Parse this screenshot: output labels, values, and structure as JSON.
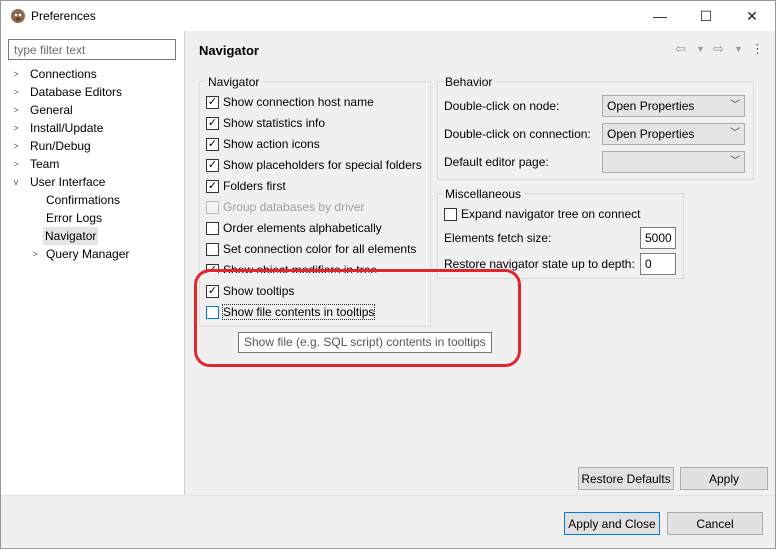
{
  "window": {
    "title": "Preferences",
    "icon": "beaver-logo-icon",
    "minimize": "—",
    "maximize": "☐",
    "close": "✕"
  },
  "filter": {
    "placeholder": "type filter text",
    "value": ""
  },
  "tree": {
    "items": [
      {
        "label": "Connections"
      },
      {
        "label": "Database Editors"
      },
      {
        "label": "General"
      },
      {
        "label": "Install/Update"
      },
      {
        "label": "Run/Debug"
      },
      {
        "label": "Team"
      },
      {
        "label": "User Interface"
      },
      {
        "label": "Confirmations"
      },
      {
        "label": "Error Logs"
      },
      {
        "label": "Navigator"
      },
      {
        "label": "Query Manager"
      }
    ]
  },
  "page": {
    "title": "Navigator"
  },
  "navigator_group": {
    "label": "Navigator",
    "options": [
      {
        "label": "Show connection host name",
        "checked": "✓"
      },
      {
        "label": "Show statistics info",
        "checked": "✓"
      },
      {
        "label": "Show action icons",
        "checked": "✓"
      },
      {
        "label": "Show placeholders for special folders",
        "checked": "✓"
      },
      {
        "label": "Folders first",
        "checked": "✓"
      },
      {
        "label": "Group databases by driver",
        "checked": ""
      },
      {
        "label": "Order elements alphabetically",
        "checked": ""
      },
      {
        "label": "Set connection color for all elements",
        "checked": ""
      },
      {
        "label": "Show object modifiers in tree",
        "checked": "✓"
      },
      {
        "label": "Show tooltips",
        "checked": "✓"
      },
      {
        "label": "Show file contents in tooltips",
        "checked": ""
      }
    ]
  },
  "behavior_group": {
    "label": "Behavior",
    "double_click_node_label": "Double-click on node:",
    "double_click_node_value": "Open Properties",
    "double_click_connection_label": "Double-click on connection:",
    "double_click_connection_value": "Open Properties",
    "default_editor_label": "Default editor page:",
    "default_editor_value": ""
  },
  "misc_group": {
    "label": "Miscellaneous",
    "expand_label": "Expand navigator tree on connect",
    "expand_checked": "",
    "fetch_label": "Elements fetch size:",
    "fetch_value": "5000",
    "restore_label": "Restore navigator state up to depth:",
    "restore_value": "0"
  },
  "tooltip": {
    "text": "Show file (e.g. SQL script) contents in tooltips"
  },
  "buttons": {
    "restore_defaults": "Restore Defaults",
    "apply": "Apply",
    "apply_close": "Apply and Close",
    "cancel": "Cancel"
  },
  "colors": {
    "highlight": "#e0262e",
    "accent": "#0078d7"
  }
}
